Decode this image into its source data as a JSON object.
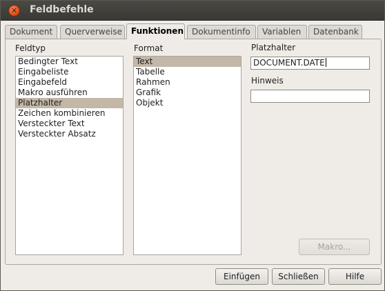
{
  "window": {
    "title": "Feldbefehle"
  },
  "tabs": [
    {
      "label": "Dokument"
    },
    {
      "label": "Querverweise"
    },
    {
      "label": "Funktionen",
      "active": true
    },
    {
      "label": "Dokumentinfo"
    },
    {
      "label": "Variablen"
    },
    {
      "label": "Datenbank"
    }
  ],
  "feldtyp": {
    "label": "Feldtyp",
    "items": [
      {
        "label": "Bedingter Text"
      },
      {
        "label": "Eingabeliste"
      },
      {
        "label": "Eingabefeld"
      },
      {
        "label": "Makro ausführen"
      },
      {
        "label": "Platzhalter",
        "selected": true
      },
      {
        "label": "Zeichen kombinieren"
      },
      {
        "label": "Versteckter Text"
      },
      {
        "label": "Versteckter Absatz"
      }
    ]
  },
  "format": {
    "label": "Format",
    "items": [
      {
        "label": "Text",
        "selected": true
      },
      {
        "label": "Tabelle"
      },
      {
        "label": "Rahmen"
      },
      {
        "label": "Grafik"
      },
      {
        "label": "Objekt"
      }
    ]
  },
  "platzhalter": {
    "label": "Platzhalter",
    "value": "DOCUMENT.DATE"
  },
  "hinweis": {
    "label": "Hinweis",
    "value": ""
  },
  "buttons": {
    "makro": "Makro...",
    "einfuegen": "Einfügen",
    "schliessen": "Schließen",
    "hilfe": "Hilfe"
  },
  "colors": {
    "titlebar": "#3c3b37",
    "selection": "#c3b7a8",
    "close_button": "#df4b16"
  }
}
